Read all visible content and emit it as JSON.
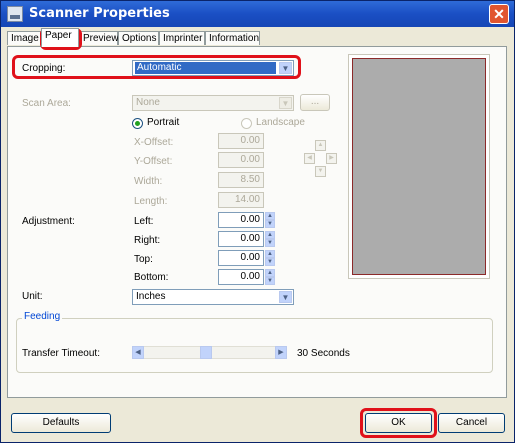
{
  "window": {
    "title": "Scanner Properties"
  },
  "tabs": [
    "Image",
    "Paper",
    "Preview",
    "Options",
    "Imprinter",
    "Information"
  ],
  "cropping": {
    "label": "Cropping:",
    "value": "Automatic"
  },
  "scan_area": {
    "label": "Scan Area:",
    "value": "None",
    "browse": "..."
  },
  "orientation": {
    "portrait": "Portrait",
    "landscape": "Landscape"
  },
  "offsets": [
    {
      "label": "X-Offset:",
      "value": "0.00"
    },
    {
      "label": "Y-Offset:",
      "value": "0.00"
    },
    {
      "label": "Width:",
      "value": "8.50"
    },
    {
      "label": "Length:",
      "value": "14.00"
    }
  ],
  "adjustment": {
    "label": "Adjustment:",
    "fields": [
      {
        "label": "Left:",
        "value": "0.00"
      },
      {
        "label": "Right:",
        "value": "0.00"
      },
      {
        "label": "Top:",
        "value": "0.00"
      },
      {
        "label": "Bottom:",
        "value": "0.00"
      }
    ]
  },
  "unit": {
    "label": "Unit:",
    "value": "Inches"
  },
  "feeding": {
    "title": "Feeding",
    "transfer_label": "Transfer Timeout:",
    "transfer_value": "30 Seconds",
    "slider_level": 0.47
  },
  "buttons": {
    "defaults": "Defaults",
    "ok": "OK",
    "cancel": "Cancel"
  },
  "colors": {
    "highlight": "#e0111a",
    "titlebar": "#1a4fc4",
    "selection": "#316ac5"
  }
}
